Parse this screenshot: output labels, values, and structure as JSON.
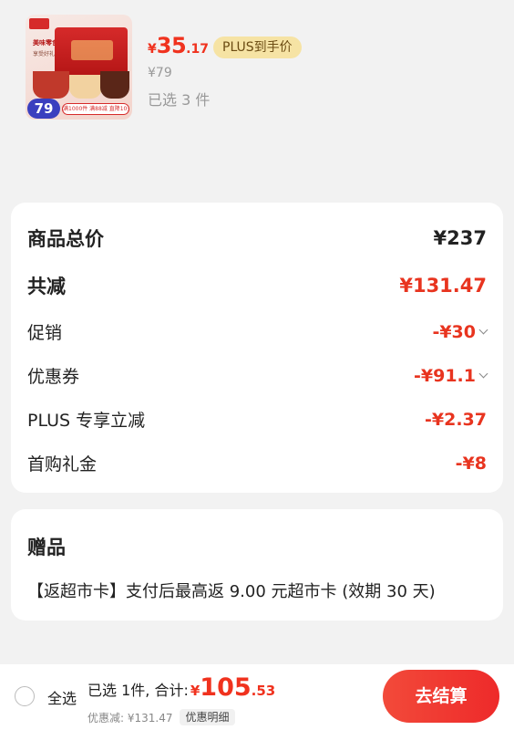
{
  "product": {
    "image_badge_price": "79",
    "image_label_top": "美味零食",
    "image_label_sub": "享受好礼",
    "image_strip_text": "满1000件 满88减 直降10元",
    "price_symbol": "¥",
    "price_integer": "35",
    "price_decimal": ".17",
    "plus_tag": "PLUS到手价",
    "original_price": "¥79",
    "selected_count": "已选 3 件"
  },
  "summary": {
    "total_label": "商品总价",
    "total_value": "¥237",
    "reduce_label": "共减",
    "reduce_value": "¥131.47",
    "promo_label": "促销",
    "promo_value": "-¥30",
    "coupon_label": "优惠券",
    "coupon_value": "-¥91.1",
    "plus_label": "PLUS 专享立减",
    "plus_value": "-¥2.37",
    "first_label": "首购礼金",
    "first_value": "-¥8"
  },
  "gift": {
    "title": "赠品",
    "text": "【返超市卡】支付后最高返 9.00 元超市卡 (效期 30 天)"
  },
  "bottom": {
    "select_all": "全选",
    "sum_label": "已选 1件, 合计:",
    "sum_symbol": "¥",
    "sum_integer": "105",
    "sum_decimal": ".53",
    "discount_text": "优惠减: ¥131.47",
    "detail_label": "优惠明细",
    "checkout_label": "去结算"
  },
  "colors": {
    "accent": "#f0321e",
    "plus_tag_bg": "#f6e3a4",
    "page_bg": "#f2f2f2"
  }
}
